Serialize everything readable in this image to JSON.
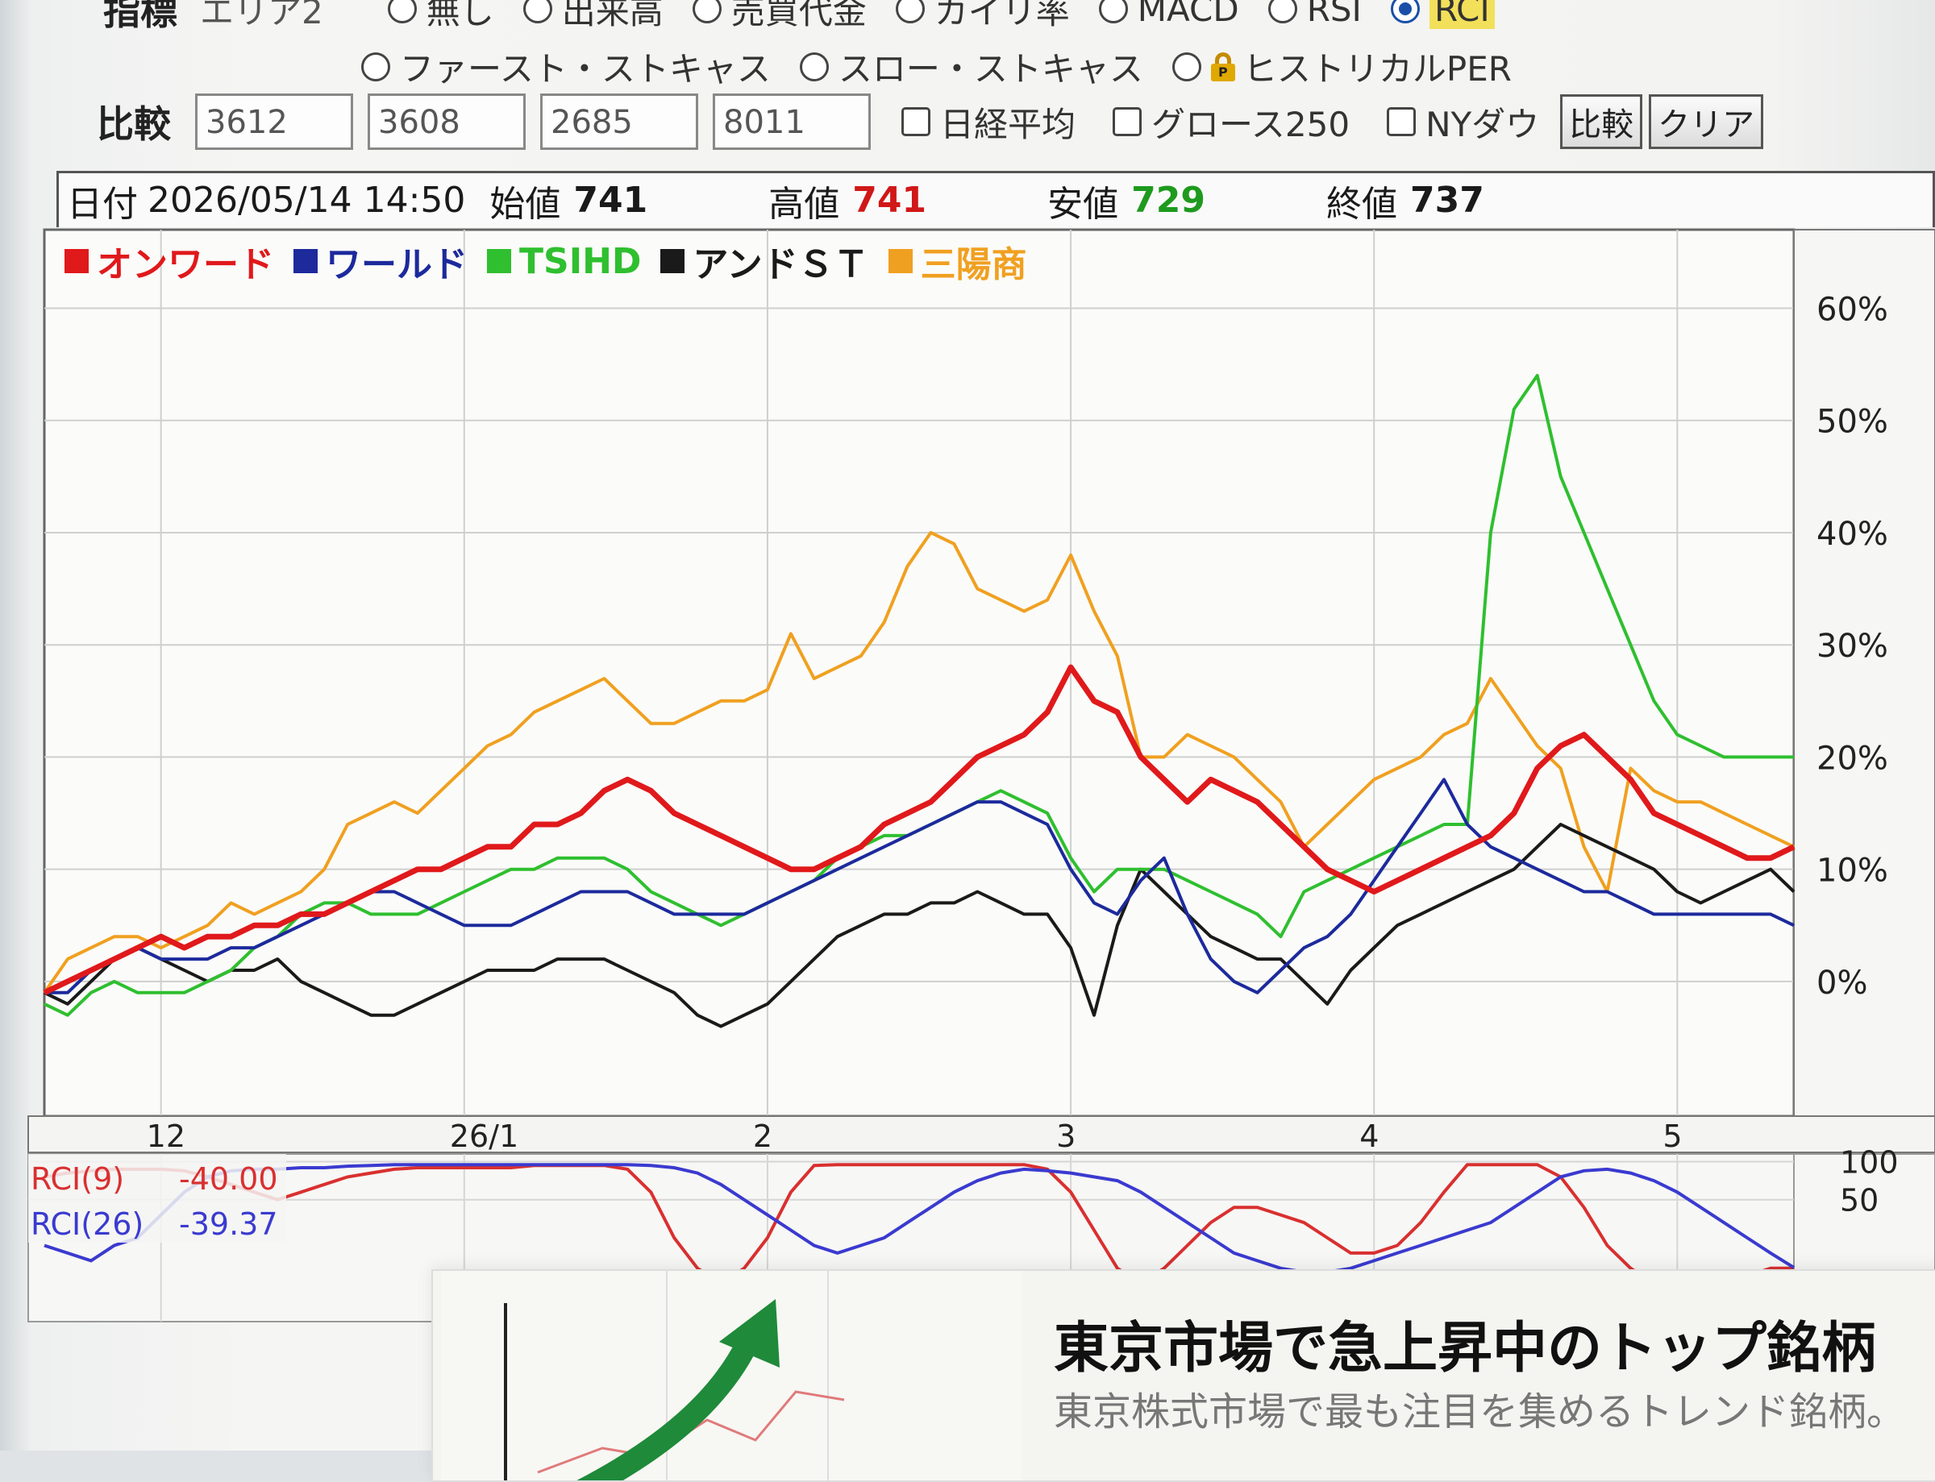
{
  "indicator_row": {
    "label": "指標",
    "area_label": "エリア2",
    "options": [
      "無し",
      "出来高",
      "売買代金",
      "カイリ率",
      "MACD",
      "RSI",
      "RCI"
    ],
    "selected": "RCI",
    "options_row2": [
      "ファースト・ストキャス",
      "スロー・ストキャス",
      "ヒストリカルPER"
    ]
  },
  "compare_row": {
    "label": "比較",
    "codes": [
      "3612",
      "3608",
      "2685",
      "8011"
    ],
    "checkboxes": [
      "日経平均",
      "グロース250",
      "NYダウ"
    ],
    "compare_button": "比較",
    "clear_button": "クリア"
  },
  "info_bar": {
    "date_label": "日付",
    "date": "2026/05/14 14:50",
    "open_label": "始値",
    "open": "741",
    "high_label": "高値",
    "high": "741",
    "low_label": "安値",
    "low": "729",
    "close_label": "終値",
    "close": "737"
  },
  "colors": {
    "onward": "#e0191b",
    "world": "#1c2a9c",
    "tsi": "#2fbf2f",
    "and_st": "#1a1a1a",
    "sanyo": "#f0a020",
    "high_value": "#d01818",
    "low_value": "#1e9a1e"
  },
  "chart_data": [
    {
      "type": "line",
      "y_unit": "%",
      "ylim": [
        -12,
        67
      ],
      "y_ticks": [
        "60%",
        "50%",
        "40%",
        "30%",
        "20%",
        "10%",
        "0%"
      ],
      "y_tick_values": [
        60,
        50,
        40,
        30,
        20,
        10,
        0
      ],
      "x_tick_labels": [
        "12",
        "26/1",
        "2",
        "3",
        "4",
        "5"
      ],
      "x_tick_positions": [
        5,
        18,
        31,
        44,
        57,
        70
      ],
      "x_points": 76,
      "grid": true,
      "legend": "top-left",
      "series": [
        {
          "name": "オンワード",
          "color_key": "onward",
          "values": [
            -1,
            0,
            1,
            2,
            3,
            4,
            3,
            4,
            4,
            5,
            5,
            6,
            6,
            7,
            8,
            9,
            10,
            10,
            11,
            12,
            12,
            14,
            14,
            15,
            17,
            18,
            17,
            15,
            14,
            13,
            12,
            11,
            10,
            10,
            11,
            12,
            14,
            15,
            16,
            18,
            20,
            21,
            22,
            24,
            28,
            25,
            24,
            20,
            18,
            16,
            18,
            17,
            16,
            14,
            12,
            10,
            9,
            8,
            9,
            10,
            11,
            12,
            13,
            15,
            19,
            21,
            22,
            20,
            18,
            15,
            14,
            13,
            12,
            11,
            11,
            12
          ]
        },
        {
          "name": "ワールド",
          "color_key": "world",
          "values": [
            -1,
            -1,
            1,
            2,
            3,
            2,
            2,
            2,
            3,
            3,
            4,
            5,
            6,
            7,
            8,
            8,
            7,
            6,
            5,
            5,
            5,
            6,
            7,
            8,
            8,
            8,
            7,
            6,
            6,
            6,
            6,
            7,
            8,
            9,
            10,
            11,
            12,
            13,
            14,
            15,
            16,
            16,
            15,
            14,
            10,
            7,
            6,
            9,
            11,
            6,
            2,
            0,
            -1,
            1,
            3,
            4,
            6,
            9,
            12,
            15,
            18,
            14,
            12,
            11,
            10,
            9,
            8,
            8,
            7,
            6,
            6,
            6,
            6,
            6,
            6,
            5
          ]
        },
        {
          "name": "TSIHD",
          "color_key": "tsi",
          "values": [
            -2,
            -3,
            -1,
            0,
            -1,
            -1,
            -1,
            0,
            1,
            3,
            4,
            6,
            7,
            7,
            6,
            6,
            6,
            7,
            8,
            9,
            10,
            10,
            11,
            11,
            11,
            10,
            8,
            7,
            6,
            5,
            6,
            7,
            8,
            9,
            11,
            12,
            13,
            13,
            14,
            15,
            16,
            17,
            16,
            15,
            11,
            8,
            10,
            10,
            10,
            9,
            8,
            7,
            6,
            4,
            8,
            9,
            10,
            11,
            12,
            13,
            14,
            14,
            40,
            51,
            54,
            45,
            40,
            35,
            30,
            25,
            22,
            21,
            20,
            20,
            20,
            20
          ]
        },
        {
          "name": "アンドＳＴ",
          "color_key": "and_st",
          "values": [
            -1,
            -2,
            0,
            2,
            3,
            2,
            1,
            0,
            1,
            1,
            2,
            0,
            -1,
            -2,
            -3,
            -3,
            -2,
            -1,
            0,
            1,
            1,
            1,
            2,
            2,
            2,
            1,
            0,
            -1,
            -3,
            -4,
            -3,
            -2,
            0,
            2,
            4,
            5,
            6,
            6,
            7,
            7,
            8,
            7,
            6,
            6,
            3,
            -3,
            5,
            10,
            8,
            6,
            4,
            3,
            2,
            2,
            0,
            -2,
            1,
            3,
            5,
            6,
            7,
            8,
            9,
            10,
            12,
            14,
            13,
            12,
            11,
            10,
            8,
            7,
            8,
            9,
            10,
            8
          ]
        },
        {
          "name": "三陽商",
          "color_key": "sanyo",
          "values": [
            -1,
            2,
            3,
            4,
            4,
            3,
            4,
            5,
            7,
            6,
            7,
            8,
            10,
            14,
            15,
            16,
            15,
            17,
            19,
            21,
            22,
            24,
            25,
            26,
            27,
            25,
            23,
            23,
            24,
            25,
            25,
            26,
            31,
            27,
            28,
            29,
            32,
            37,
            40,
            39,
            35,
            34,
            33,
            34,
            38,
            33,
            29,
            20,
            20,
            22,
            21,
            20,
            18,
            16,
            12,
            14,
            16,
            18,
            19,
            20,
            22,
            23,
            27,
            24,
            21,
            19,
            12,
            8,
            19,
            17,
            16,
            16,
            15,
            14,
            13,
            12
          ]
        }
      ]
    },
    {
      "type": "line",
      "ylim": [
        -110,
        110
      ],
      "y_ticks": [
        "100",
        "50"
      ],
      "y_tick_values": [
        100,
        50
      ],
      "series": [
        {
          "name": "RCI(9)",
          "value_label": "-40.00",
          "color": "#d93030",
          "values": [
            80,
            85,
            88,
            90,
            90,
            90,
            88,
            80,
            70,
            60,
            50,
            60,
            70,
            80,
            85,
            90,
            92,
            92,
            92,
            92,
            92,
            95,
            95,
            95,
            95,
            90,
            60,
            0,
            -40,
            -60,
            -40,
            0,
            60,
            95,
            96,
            96,
            96,
            96,
            96,
            96,
            96,
            96,
            96,
            90,
            60,
            10,
            -40,
            -60,
            -40,
            -10,
            20,
            40,
            40,
            30,
            20,
            0,
            -20,
            -20,
            -10,
            20,
            60,
            96,
            96,
            96,
            96,
            80,
            40,
            -10,
            -40,
            -60,
            -60,
            -50,
            -50,
            -50,
            -40,
            -40
          ]
        },
        {
          "name": "RCI(26)",
          "value_label": "-39.37",
          "color": "#3a3ad0",
          "values": [
            -10,
            -20,
            -30,
            -10,
            0,
            30,
            60,
            80,
            88,
            90,
            90,
            92,
            92,
            94,
            95,
            96,
            96,
            96,
            96,
            96,
            96,
            96,
            96,
            96,
            96,
            96,
            95,
            92,
            85,
            70,
            50,
            30,
            10,
            -10,
            -20,
            -10,
            0,
            20,
            40,
            60,
            75,
            85,
            90,
            88,
            85,
            80,
            75,
            60,
            40,
            20,
            0,
            -20,
            -30,
            -40,
            -45,
            -45,
            -40,
            -30,
            -20,
            -10,
            0,
            10,
            20,
            40,
            60,
            80,
            88,
            90,
            85,
            75,
            60,
            40,
            20,
            0,
            -20,
            -39
          ]
        }
      ]
    }
  ],
  "popup": {
    "title": "東京市場で急上昇中のトップ銘柄",
    "subtitle": "東京株式市場で最も注目を集めるトレンド銘柄。"
  }
}
